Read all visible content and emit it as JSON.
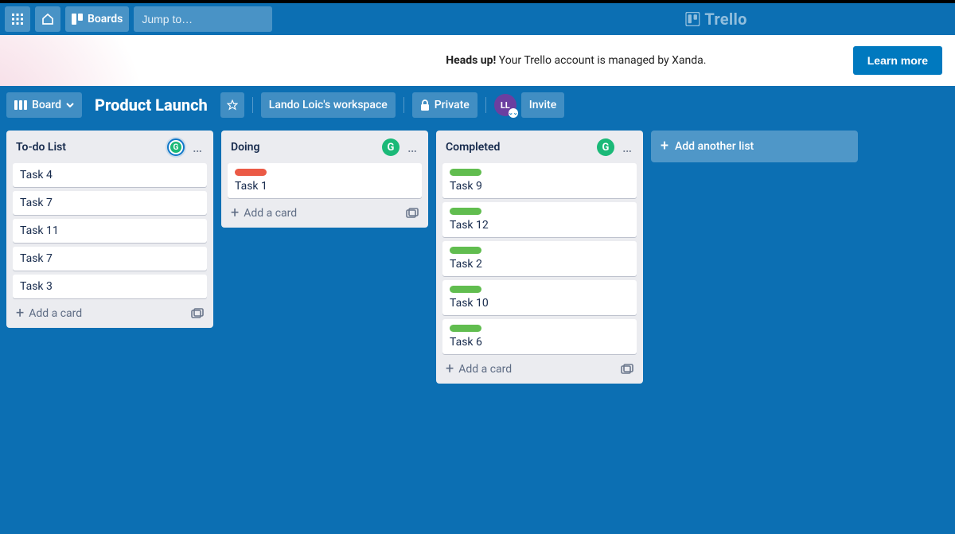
{
  "header": {
    "boards_label": "Boards",
    "search_placeholder": "Jump to…",
    "brand": "Trello"
  },
  "banner": {
    "strong": "Heads up!",
    "message": " Your Trello account is managed by Xanda.",
    "learn_more": "Learn more"
  },
  "board_header": {
    "view_label": "Board",
    "title": "Product Launch",
    "workspace": "Lando Loic's workspace",
    "visibility": "Private",
    "avatar_initials": "LL",
    "invite": "Invite"
  },
  "lists": [
    {
      "title": "To-do List",
      "badge_ring": true,
      "cards": [
        {
          "label": null,
          "title": "Task 4"
        },
        {
          "label": null,
          "title": "Task 7"
        },
        {
          "label": null,
          "title": "Task 11"
        },
        {
          "label": null,
          "title": "Task 7"
        },
        {
          "label": null,
          "title": "Task 3"
        }
      ],
      "add_card": "Add a card"
    },
    {
      "title": "Doing",
      "badge_ring": false,
      "cards": [
        {
          "label": "red",
          "title": "Task 1"
        }
      ],
      "add_card": "Add a card"
    },
    {
      "title": "Completed",
      "badge_ring": false,
      "cards": [
        {
          "label": "green",
          "title": "Task 9"
        },
        {
          "label": "green",
          "title": "Task 12"
        },
        {
          "label": "green",
          "title": "Task 2"
        },
        {
          "label": "green",
          "title": "Task 10"
        },
        {
          "label": "green",
          "title": "Task 6"
        }
      ],
      "add_card": "Add a card"
    }
  ],
  "add_another_list": "Add another list"
}
